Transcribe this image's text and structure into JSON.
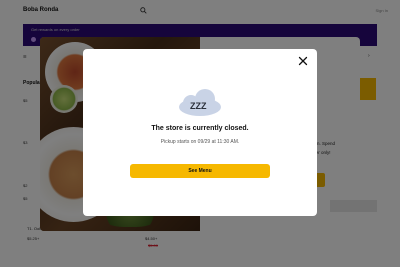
{
  "header": {
    "store_name": "Boba Ronda",
    "right_text": "Sign In"
  },
  "banner": {
    "text": "Get rewards on every order"
  },
  "menu": {
    "section_label": "Popular",
    "left_snippets": [
      "☰",
      "$5",
      "$3",
      "$2",
      "$5"
    ],
    "items": [
      {
        "name": "T1. Oolon...",
        "price": "$5.25+"
      },
      {
        "name": "Fa...",
        "price": "$4.50+",
        "old_price": "$5.00"
      }
    ],
    "promo_lines": [
      "...m. Spend",
      "...er only!"
    ]
  },
  "modal": {
    "title": "The store is currently closed.",
    "subtitle": "Pickup starts on 09/29 at 11:30 AM.",
    "button_label": "See Menu",
    "icon": "sleeping-cloud-icon",
    "icon_text": "ZZZ"
  },
  "colors": {
    "accent": "#F6B800",
    "banner": "#2C0A78",
    "overlay": "rgba(0,0,0,0.5)"
  }
}
